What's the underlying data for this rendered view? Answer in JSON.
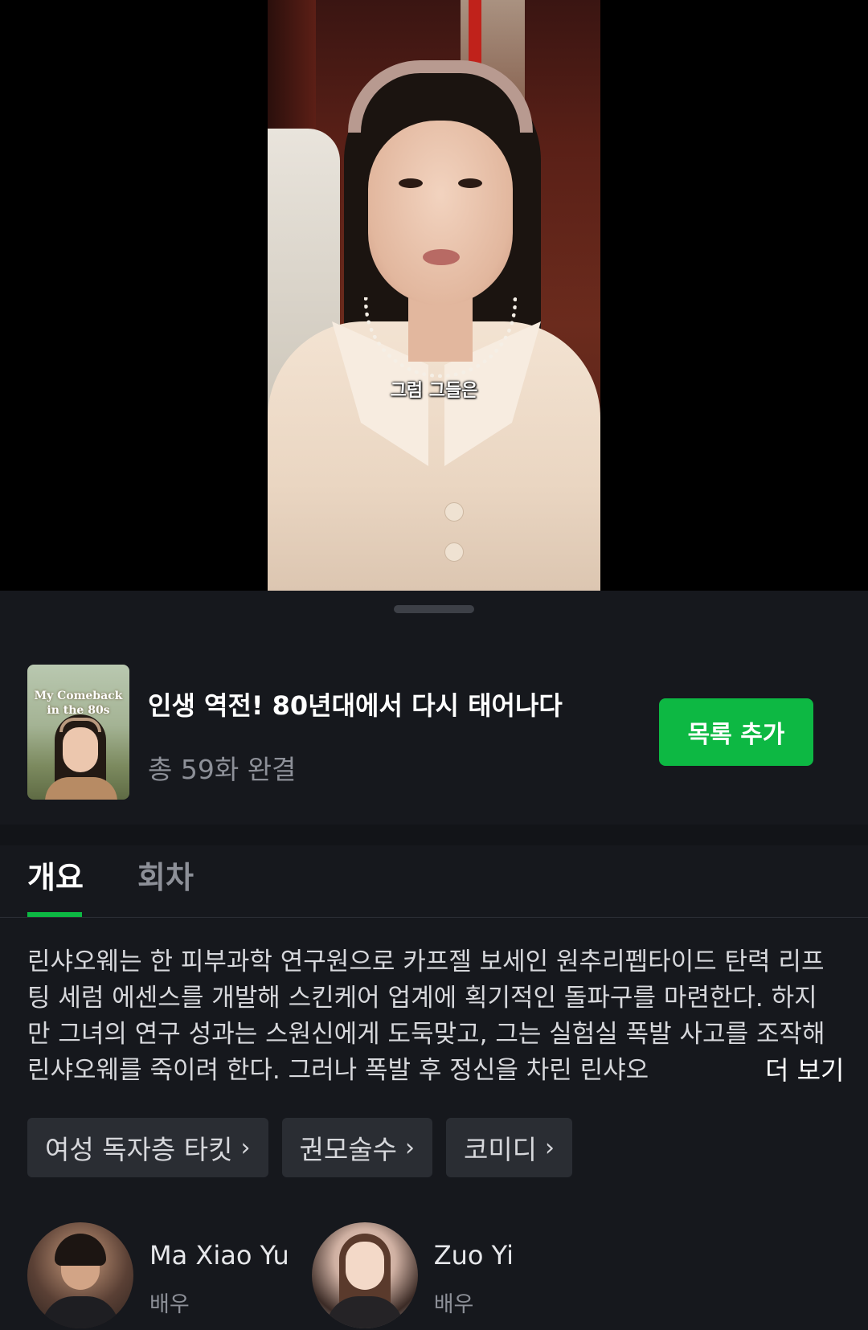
{
  "video": {
    "subtitle": "그럼 그들은"
  },
  "show": {
    "poster_title": "My Comeback in the 80s",
    "title": "인생 역전! 80년대에서 다시 태어나다",
    "meta": "총 59화 완결",
    "add_button_label": "목록 추가"
  },
  "tabs": {
    "overview": "개요",
    "episodes": "회차"
  },
  "synopsis": {
    "text": "린샤오웨는 한 피부과학 연구원으로 카프젤 보세인 원추리펩타이드 탄력 리프팅 세럼 에센스를 개발해 스킨케어 업계에 획기적인 돌파구를 마련한다. 하지만 그녀의 연구 성과는 스원신에게 도둑맞고, 그는 실험실 폭발 사고를 조작해 린샤오웨를 죽이려 한다. 그러나 폭발 후 정신을 차린 린샤오",
    "more_label": "더 보기"
  },
  "tags": [
    {
      "label": "여성 독자층 타킷"
    },
    {
      "label": "권모술수"
    },
    {
      "label": "코미디"
    }
  ],
  "cast": [
    {
      "name": "Ma Xiao Yu",
      "role": "배우"
    },
    {
      "name": "Zuo Yi",
      "role": "배우"
    }
  ],
  "colors": {
    "accent": "#0db843",
    "background": "#16181d"
  },
  "icons": {
    "tag_chevron": "chevron-right-icon"
  }
}
